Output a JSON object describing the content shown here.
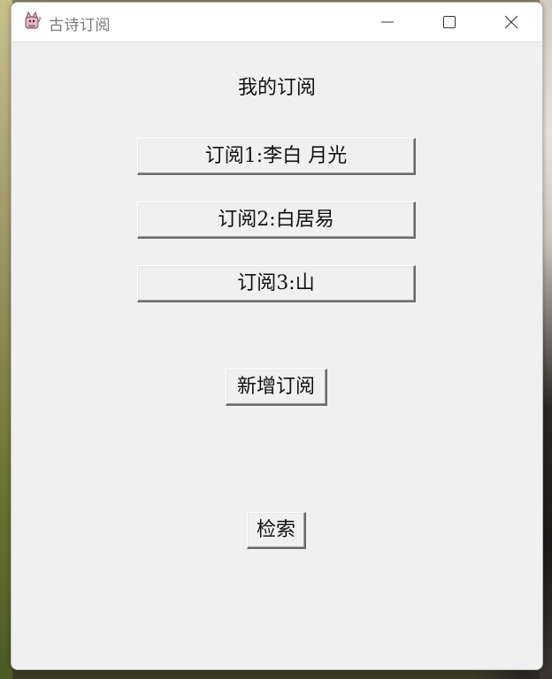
{
  "window": {
    "title": "古诗订阅",
    "app_icon": "cat-icon",
    "controls": {
      "minimize_icon": "minimize-icon",
      "maximize_icon": "maximize-icon",
      "close_icon": "close-icon"
    }
  },
  "main": {
    "heading": "我的订阅",
    "subscriptions": [
      {
        "label": "订阅1:李白 月光"
      },
      {
        "label": "订阅2:白居易"
      },
      {
        "label": "订阅3:山"
      }
    ],
    "add_label": "新增订阅",
    "search_label": "检索"
  },
  "colors": {
    "window_bg": "#f0f0f0",
    "titlebar_bg": "#ffffff",
    "title_text": "#7a7a7a",
    "button_shadow": "#6a6a6a"
  }
}
